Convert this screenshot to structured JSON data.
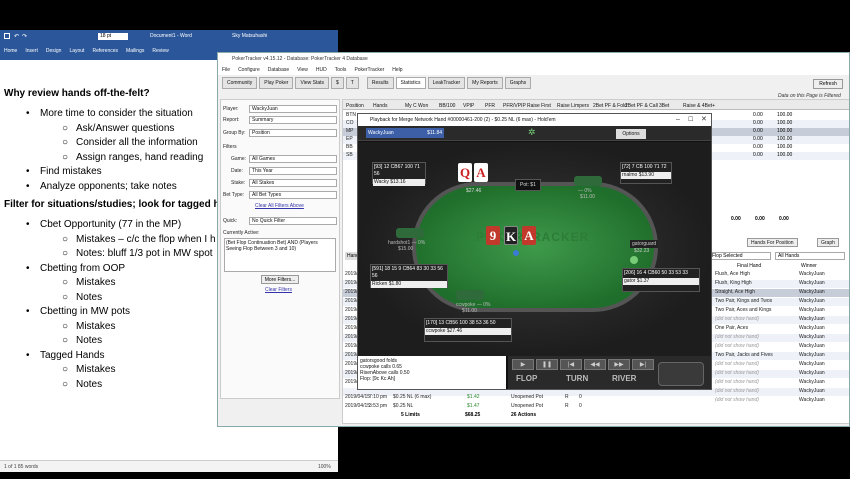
{
  "word": {
    "title": "Document1 - Word",
    "user": "Sky Matsuhashi",
    "font_size": "18 pt",
    "ribbon_tabs": [
      "Home",
      "Insert",
      "Design",
      "Layout",
      "References",
      "Mailings",
      "Review"
    ],
    "lines": [
      {
        "level": 0,
        "text": "Why review hands off-the-felt?"
      },
      {
        "level": 1,
        "text": "More time to consider the situation"
      },
      {
        "level": 2,
        "text": "Ask/Answer questions"
      },
      {
        "level": 2,
        "text": "Consider all the information"
      },
      {
        "level": 2,
        "text": "Assign ranges, hand reading"
      },
      {
        "level": 1,
        "text": "Find mistakes"
      },
      {
        "level": 1,
        "text": "Analyze opponents; take notes"
      },
      {
        "level": 0,
        "text": "Filter for situations/studies; look for tagged hands"
      },
      {
        "level": 1,
        "text": "Cbet Opportunity (77 in the MP)"
      },
      {
        "level": 2,
        "text": "Mistakes – c/c the flop when I h"
      },
      {
        "level": 2,
        "text": "Notes: bluff 1/3 pot in MW spot"
      },
      {
        "level": 1,
        "text": "Cbetting from OOP"
      },
      {
        "level": 2,
        "text": "Mistakes"
      },
      {
        "level": 2,
        "text": "Notes"
      },
      {
        "level": 1,
        "text": "Cbetting in MW pots"
      },
      {
        "level": 2,
        "text": "Mistakes"
      },
      {
        "level": 2,
        "text": "Notes"
      },
      {
        "level": 1,
        "text": "Tagged Hands"
      },
      {
        "level": 2,
        "text": "Mistakes"
      },
      {
        "level": 2,
        "text": "Notes"
      }
    ],
    "status": "1 of 1    85 words",
    "zoom": "100%"
  },
  "pt": {
    "title": "PokerTracker v4.15.12 - Database: PokerTracker 4 Database",
    "menu": [
      "File",
      "Configure",
      "Database",
      "View",
      "HUD",
      "Tools",
      "PokerTracker",
      "Help"
    ],
    "tabs": [
      "Community",
      "Play Poker",
      "View Stats",
      "$",
      "T",
      "Results",
      "Statistics",
      "LeakTracker",
      "My Reports",
      "Graphs"
    ],
    "refresh": "Refresh",
    "filtered_note": "Data on this Page is Filtered",
    "player_label": "Player:",
    "player": "WackyJuan",
    "report_label": "Report:",
    "report": "Summary",
    "groupby_label": "Group By:",
    "groupby": "Position",
    "filters_label": "Filters",
    "game_label": "Game:",
    "game": "All Games",
    "date_label": "Date:",
    "date": "This Year",
    "stake_label": "Stake:",
    "stake": "All Stakes",
    "bettype_label": "Bet Type:",
    "bettype": "All Bet Types",
    "clear_all": "Clear All Filters Above",
    "quick_label": "Quick:",
    "quick": "No Quick Filter",
    "currently_active": "Currently Active:",
    "active_filter": "(Bet Flop Continuation Bet) AND (Players Seeing Flop Between 3 and 10)",
    "more_filters": "More Filters...",
    "clear_filters": "Clear Filters",
    "columns": [
      "Position",
      "Hands",
      "My C Won",
      "BB/100",
      "VPIP",
      "PFR",
      "PFR/VPIP",
      "Raise First",
      "Raise Limpers",
      "2Bet PF & Fold",
      "2Bet PF & Call",
      "3Bet",
      "Raise & 4Bet+"
    ],
    "positions": [
      "BTN",
      "CO",
      "MP",
      "EP",
      "BB",
      "SB"
    ],
    "stat_values": [
      "0.00",
      "100.00",
      "0.00",
      "100.00",
      "0.00",
      "100.00",
      "0.00",
      "100.00",
      "0.00",
      "100.00",
      "0.00",
      "100.00"
    ],
    "totals": [
      "0.00",
      "0.00",
      "0.00"
    ],
    "hands_for_position": "Hands For Position",
    "graph": "Graph",
    "hand_tab": "Hand",
    "flop_selected": "Flop Selected",
    "all_hands": "All Hands",
    "final_hand_header": "Final Hand",
    "winner_header": "Winner",
    "final_hands": [
      "Flush, Ace High",
      "Flush, King High",
      "Straight, Ace High",
      "Two Pair, Kings and Twos",
      "Two Pair, Aces and Kings",
      "(did not show hand)",
      "One Pair, Aces",
      "(did not show hand)",
      "(did not show hand)",
      "Two Pair, Jacks and Fives",
      "(did not show hand)",
      "(did not show hand)",
      "(did not show hand)",
      "(did not show hand)",
      "(did not show hand)"
    ],
    "winners": [
      "WackyJuan",
      "WackyJuan",
      "WackyJuan",
      "WackyJuan",
      "WackyJuan",
      "WackyJuan",
      "WackyJuan",
      "WackyJuan",
      "WackyJuan",
      "WackyJuan",
      "WackyJuan",
      "WackyJuan",
      "WackyJuan",
      "WackyJuan",
      "WackyJuan"
    ],
    "row_dates": [
      "2019/",
      "2019/",
      "2019/",
      "2019/",
      "2019/",
      "2019/",
      "2019/",
      "2019/",
      "2019/",
      "2019/",
      "2019/",
      "2019/",
      "2019/"
    ],
    "bottom_rows": [
      {
        "date": "2019/04/15",
        "time": "7:10 pm",
        "stake": "$0.25 NL (6 max)",
        "won": "$1.42",
        "pot": "Unopened Pot",
        "p1": "R",
        "p2": "0"
      },
      {
        "date": "2019/04/15",
        "time": "3:53 pm",
        "stake": "$0.25 NL",
        "won": "$1.47",
        "pot": "Unopened Pot",
        "p1": "R",
        "p2": "0"
      }
    ],
    "summary_limits": "5 Limits",
    "summary_won": "$68.25",
    "summary_actions": "26 Actions"
  },
  "replayer": {
    "title": "Playback for Merge Network Hand #00000461-200 (2) - $0.25 NL (6 max) - Hold'em",
    "hero": "WackyJuan",
    "hero_stack": "$11.84",
    "options": "Options",
    "pot": "Pot: $1",
    "logo": "POKERTRACKER",
    "hero_cards": [
      {
        "rank": "Q",
        "suit": "red"
      },
      {
        "rank": "A",
        "suit": "red"
      }
    ],
    "hero_seat_stack": "$27.46",
    "board": [
      {
        "rank": "9",
        "style": "red"
      },
      {
        "rank": "K",
        "style": "blk"
      },
      {
        "rank": "A",
        "style": "red"
      }
    ],
    "seats": [
      {
        "name": "Wacky",
        "stack": "$13.16",
        "hud": "[93] 12 CB67 100 71 56"
      },
      {
        "name": "rnalmo",
        "stack": "$13.90",
        "hud": "[72] 7 CB 100 71 72"
      },
      {
        "name": "Ricken",
        "stack": "$1.80",
        "hud": "[591] 18 15 9 CB64 83 30 33 56 56"
      },
      {
        "name": "gator",
        "stack": "$1.37",
        "hud": "[206] 16 4 CB60 50 33 53 33"
      },
      {
        "name": "ccwpoke",
        "stack": "$27.46",
        "hud": "[170] 13 CB56 100 38 53 36 50"
      },
      {
        "name": "gatorguard",
        "stack": "$32.23",
        "hud": ""
      }
    ],
    "seat_labels": [
      "— 0%",
      "— 0%",
      "hardshot1 — 0%",
      "ccwpoke — 0%"
    ],
    "seat_stacks": [
      "$11.00",
      "$11.00",
      "$15.00"
    ],
    "log": [
      "gatorsgood folds",
      "ccwpoke calls 0.65",
      "RisenAbove calls 0.50",
      "Flop: [9c Kc Ah]"
    ],
    "controls": [
      "▶",
      "❚❚",
      "|◀",
      "◀◀",
      "▶▶",
      "▶|"
    ],
    "streets": [
      "FLOP",
      "TURN",
      "RIVER"
    ]
  },
  "colors": {
    "word_blue": "#2b579a",
    "felt": "#2f8a3e",
    "card_red": "#c0392b"
  }
}
